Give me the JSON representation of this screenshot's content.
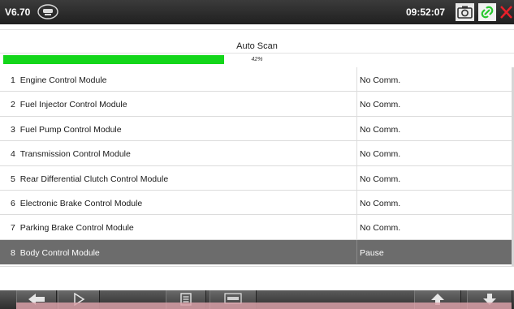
{
  "header": {
    "version": "V6.70",
    "vci_icon": "vci-connection-icon",
    "time": "09:52:07",
    "icons": [
      "camera-icon",
      "link-icon",
      "close-icon"
    ]
  },
  "scan": {
    "title": "Auto Scan",
    "progress_percent": 42,
    "progress_text": "42%"
  },
  "modules": [
    {
      "index": "1",
      "name": "Engine Control Module",
      "status": "No Comm."
    },
    {
      "index": "2",
      "name": "Fuel Injector Control Module",
      "status": "No Comm."
    },
    {
      "index": "3",
      "name": "Fuel Pump Control Module",
      "status": "No Comm."
    },
    {
      "index": "4",
      "name": "Transmission Control Module",
      "status": "No Comm."
    },
    {
      "index": "5",
      "name": "Rear Differential Clutch Control Module",
      "status": "No Comm."
    },
    {
      "index": "6",
      "name": "Electronic Brake Control Module",
      "status": "No Comm."
    },
    {
      "index": "7",
      "name": "Parking Brake Control Module",
      "status": "No Comm."
    },
    {
      "index": "8",
      "name": "Body Control Module",
      "status": "Pause",
      "selected": true
    }
  ],
  "toolbar": {
    "buttons": [
      "back-icon",
      "play-icon",
      "document-icon",
      "report-icon",
      "scroll-up-icon",
      "scroll-down-icon"
    ]
  },
  "colors": {
    "header_bg": "#2b2b2b",
    "progress_green": "#13d61a",
    "selected_row": "#6c6c6c",
    "close_red": "#e8202a",
    "link_green": "#28c82e"
  }
}
